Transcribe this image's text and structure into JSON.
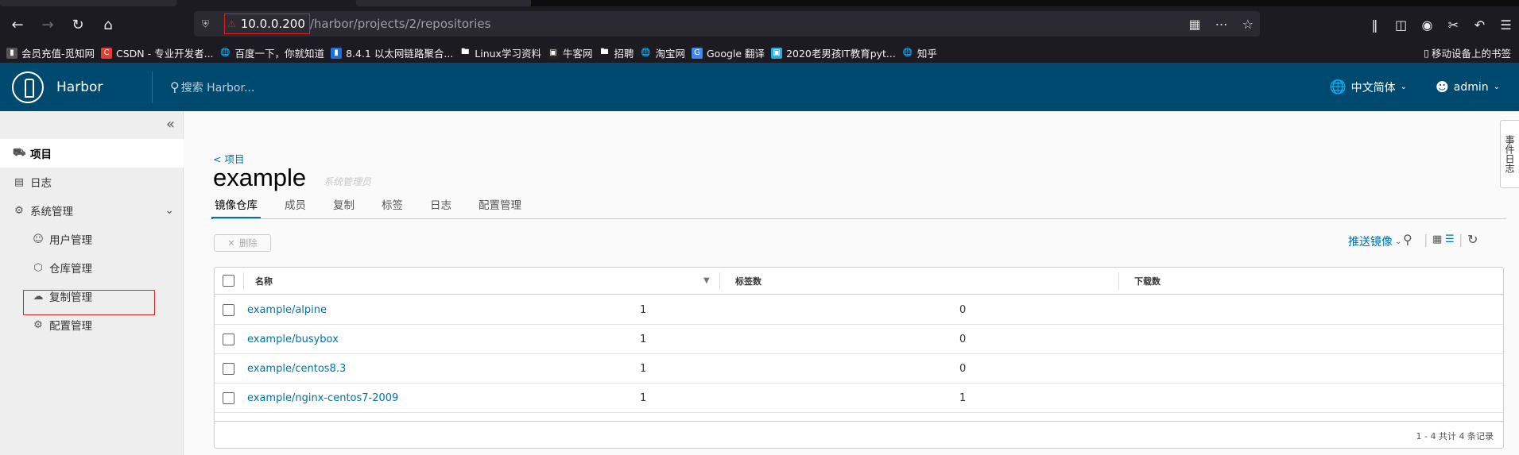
{
  "browser": {
    "url_host": "10.0.0.200",
    "url_path": "/harbor/projects/2/repositories",
    "bookmarks": [
      {
        "label": "会员充值-觅知网",
        "icon": "bookmark-icon",
        "color": "#555"
      },
      {
        "label": "CSDN - 专业开发者...",
        "icon": "csdn-icon",
        "color": "#e33e33"
      },
      {
        "label": "百度一下，你就知道",
        "icon": "globe-icon",
        "color": "#555"
      },
      {
        "label": "8.4.1 以太网链路聚合...",
        "icon": "page-icon",
        "color": "#1e6fd9"
      },
      {
        "label": "Linux学习资料",
        "icon": "folder-icon",
        "color": "#555"
      },
      {
        "label": "牛客网",
        "icon": "nowcoder-icon",
        "color": "#222"
      },
      {
        "label": "招聘",
        "icon": "folder-icon",
        "color": "#555"
      },
      {
        "label": "淘宝网",
        "icon": "globe-icon",
        "color": "#555"
      },
      {
        "label": "Google 翻译",
        "icon": "translate-icon",
        "color": "#4285f4"
      },
      {
        "label": "2020老男孩IT教育pyt...",
        "icon": "bilibili-icon",
        "color": "#23ade5"
      },
      {
        "label": "知乎",
        "icon": "globe-icon",
        "color": "#555"
      }
    ],
    "mobile_bookmarks": "移动设备上的书签"
  },
  "header": {
    "brand": "Harbor",
    "search_placeholder": "搜索 Harbor...",
    "language": "中文简体",
    "user": "admin"
  },
  "sidebar": {
    "items": [
      {
        "label": "项目",
        "icon": "projects-icon",
        "active": true
      },
      {
        "label": "日志",
        "icon": "logs-icon"
      },
      {
        "label": "系统管理",
        "icon": "admin-icon"
      },
      {
        "label": "用户管理",
        "icon": "users-icon"
      },
      {
        "label": "仓库管理",
        "icon": "registry-icon"
      },
      {
        "label": "复制管理",
        "icon": "replication-icon"
      },
      {
        "label": "配置管理",
        "icon": "config-icon"
      }
    ]
  },
  "main": {
    "back_link": "< 项目",
    "project_name": "example",
    "role": "系统管理员",
    "tabs": [
      "镜像仓库",
      "成员",
      "复制",
      "标签",
      "日志",
      "配置管理"
    ],
    "delete_label": "删除",
    "push_label": "推送镜像",
    "columns": [
      "名称",
      "标签数",
      "下载数"
    ],
    "rows": [
      {
        "name": "example/alpine",
        "tags": "1",
        "pulls": "0"
      },
      {
        "name": "example/busybox",
        "tags": "1",
        "pulls": "0"
      },
      {
        "name": "example/centos8.3",
        "tags": "1",
        "pulls": "0"
      },
      {
        "name": "example/nginx-centos7-2009",
        "tags": "1",
        "pulls": "1"
      }
    ],
    "pagination": "1 - 4 共计 4 条记录"
  },
  "float_panel": "事件日志"
}
